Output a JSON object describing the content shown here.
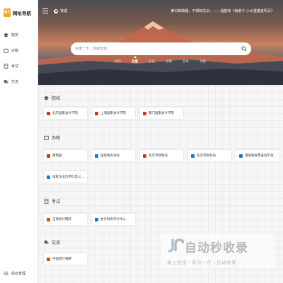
{
  "app": {
    "logo_badge": "BT",
    "logo_text": "网址导航"
  },
  "sidebar": {
    "items": [
      {
        "label": "院校",
        "icon": "graduation-cap-icon"
      },
      {
        "label": "办税",
        "icon": "calendar-icon"
      },
      {
        "label": "考试",
        "icon": "book-icon"
      },
      {
        "label": "交流",
        "icon": "chat-icon"
      }
    ],
    "bottom": {
      "label": "后台管理",
      "icon": "gear-icon"
    }
  },
  "header": {
    "skin_label": "管理",
    "quote": "佛曰禅随踵，不相知先识。——温庭筠《南歌子·小山重叠金明灭》",
    "search": {
      "placeholder": "百度一下，你就知道"
    },
    "tabs": [
      "站内",
      "百度",
      "必应",
      "谷歌",
      "软件",
      "文献"
    ],
    "active_tab": "百度"
  },
  "sections": [
    {
      "title": "院校",
      "icon": "graduation-cap-icon",
      "cards": [
        {
          "label": "北京国家会计学院",
          "color": "#c0392b"
        },
        {
          "label": "上海国家会计学院",
          "color": "#c0392b"
        },
        {
          "label": "厦门国家会计学院",
          "color": "#c0392b"
        }
      ]
    },
    {
      "title": "办税",
      "icon": "calendar-icon",
      "cards": [
        {
          "label": "财政部",
          "color": "#c0392b"
        },
        {
          "label": "国家税务总局",
          "color": "#2c6fbf"
        },
        {
          "label": "北京市财政局",
          "color": "#c0392b"
        },
        {
          "label": "北京市税务局",
          "color": "#2c6fbf"
        },
        {
          "label": "增值税发票查验平台",
          "color": "#2c6fbf"
        },
        {
          "label": "国家企业信用信息公...",
          "color": "#2c6fbf"
        }
      ]
    },
    {
      "title": "考试",
      "icon": "book-icon",
      "cards": [
        {
          "label": "正保会计网校",
          "color": "#d35400"
        },
        {
          "label": "会计财务评价中心",
          "color": "#2c6fbf"
        }
      ]
    },
    {
      "title": "交流",
      "icon": "chat-icon",
      "cards": [
        {
          "label": "中国会计视野",
          "color": "#d35400"
        }
      ]
    }
  ],
  "watermark": {
    "main": "自动秒收录",
    "sub": "做上链接→来访一次→自动收录"
  }
}
